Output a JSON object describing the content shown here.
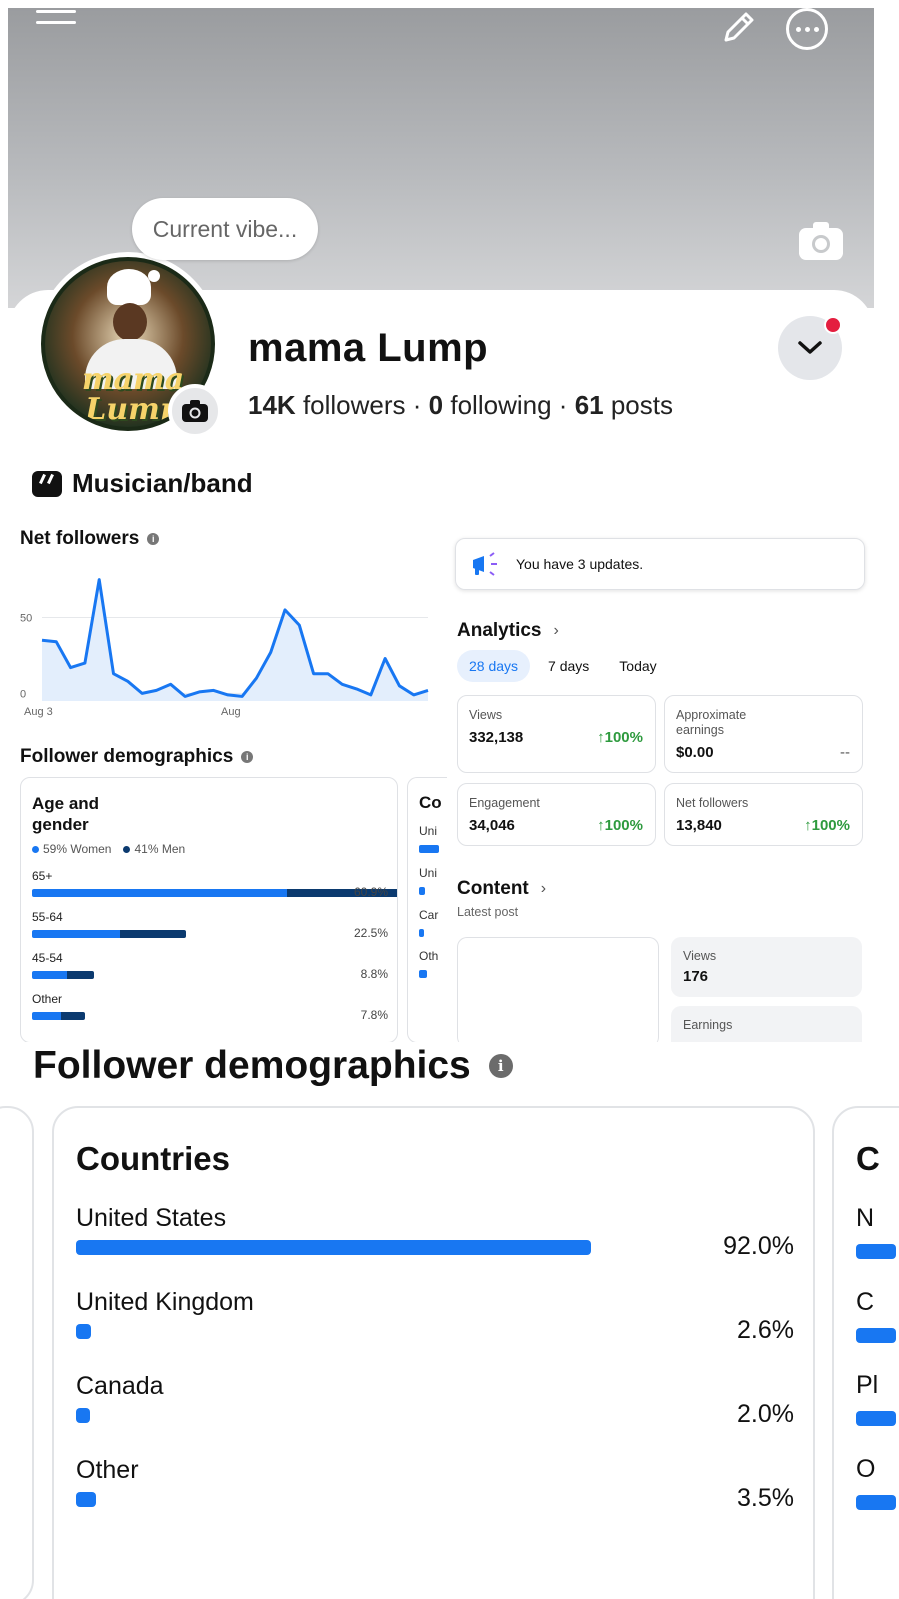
{
  "cover": {
    "vibe_placeholder": "Current vibe..."
  },
  "profile": {
    "name": "mama Lump",
    "followers_count": "14K",
    "followers_label": "followers",
    "following_count": "0",
    "following_label": "following",
    "posts_count": "61",
    "posts_label": "posts",
    "separator": "·",
    "category": "Musician/band",
    "avatar_logo_text": "mama Lump"
  },
  "net_followers": {
    "title": "Net followers",
    "info": "i",
    "chart_data": {
      "type": "area",
      "x_start_label": "Aug 3",
      "x_mid_label": "Aug",
      "yticks": [
        0,
        50
      ],
      "ylim": [
        -5,
        80
      ],
      "values": [
        35,
        34,
        17,
        20,
        75,
        13,
        8,
        0,
        2,
        6,
        -2,
        1,
        2,
        -1,
        -2,
        10,
        27,
        55,
        45,
        13,
        13,
        6,
        3,
        -1,
        23,
        5,
        -1,
        2
      ]
    }
  },
  "demographics": {
    "title": "Follower demographics",
    "info": "i",
    "age_gender": {
      "title": "Age and gender",
      "women_label": "59% Women",
      "men_label": "41% Men",
      "colors": {
        "women": "#1877f2",
        "men": "#0b3a6f"
      },
      "rows": [
        {
          "label": "65+",
          "women": 0.58,
          "men": 0.37,
          "pct": "60.9%"
        },
        {
          "label": "55-64",
          "women": 0.2,
          "men": 0.15,
          "pct": "22.5%"
        },
        {
          "label": "45-54",
          "women": 0.08,
          "men": 0.06,
          "pct": "8.8%"
        },
        {
          "label": "Other",
          "women": 0.065,
          "men": 0.055,
          "pct": "7.8%"
        }
      ]
    },
    "countries_small": {
      "title": "Co",
      "rows": [
        "Uni",
        "Uni",
        "Car",
        "Oth"
      ]
    }
  },
  "updates": {
    "text": "You have 3 updates."
  },
  "analytics": {
    "title": "Analytics",
    "chevron": "›",
    "tabs": [
      "28 days",
      "7 days",
      "Today"
    ],
    "metrics": [
      {
        "label": "Views",
        "value": "332,138",
        "trend": "↑100%"
      },
      {
        "label": "Approximate earnings",
        "value": "$0.00",
        "trend": "--"
      },
      {
        "label": "Engagement",
        "value": "34,046",
        "trend": "↑100%"
      },
      {
        "label": "Net followers",
        "value": "13,840",
        "trend": "↑100%"
      }
    ]
  },
  "content": {
    "title": "Content",
    "chevron": "›",
    "subtitle": "Latest post",
    "views_label": "Views",
    "views_value": "176",
    "earnings_label": "Earnings"
  },
  "big_demographics": {
    "title": "Follower demographics",
    "info": "i",
    "countries": {
      "title": "Countries",
      "rows": [
        {
          "name": "United States",
          "value": 0.92,
          "pct": "92.0%"
        },
        {
          "name": "United Kingdom",
          "value": 0.026,
          "pct": "2.6%"
        },
        {
          "name": "Canada",
          "value": 0.02,
          "pct": "2.0%"
        },
        {
          "name": "Other",
          "value": 0.035,
          "pct": "3.5%"
        }
      ]
    },
    "next_card": {
      "title": "C",
      "rows": [
        "N",
        "C",
        "Pl",
        "O"
      ]
    }
  }
}
